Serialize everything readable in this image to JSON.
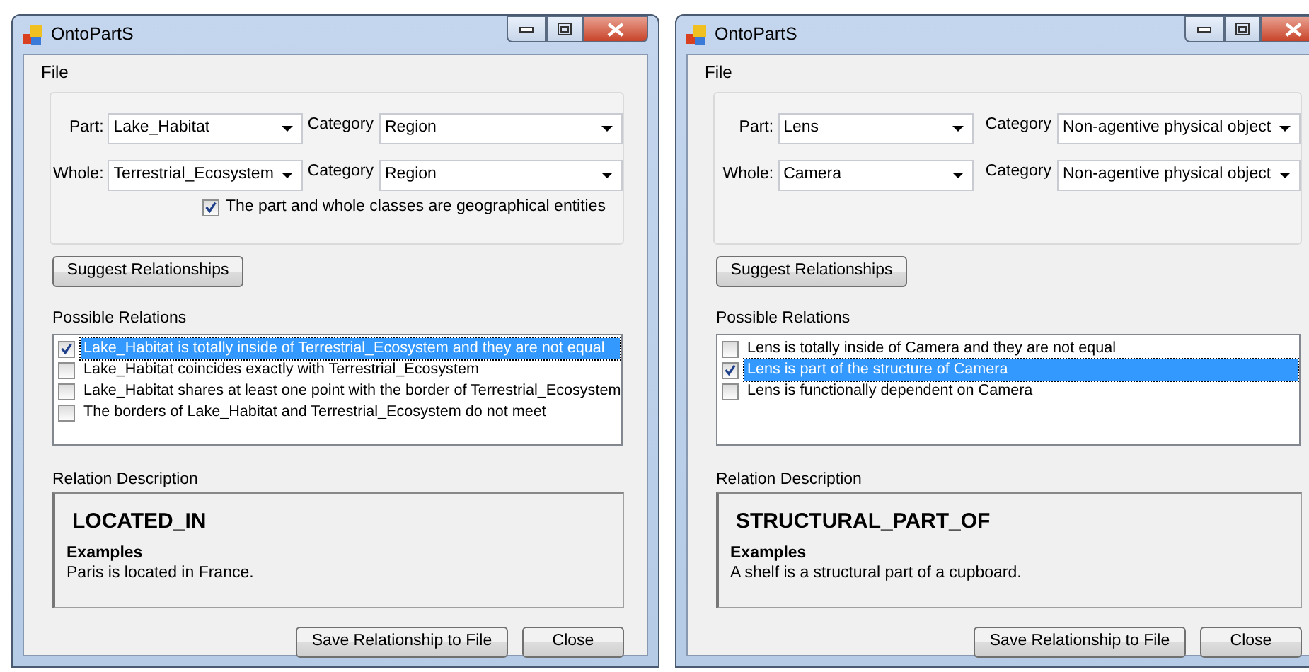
{
  "windows": [
    {
      "title": "OntoPartS",
      "menu": [
        "File"
      ],
      "part": {
        "label": "Part:",
        "value": "Lake_Habitat",
        "category_label": "Category",
        "category": "Region"
      },
      "whole": {
        "label": "Whole:",
        "value": "Terrestrial_Ecosystem",
        "category_label": "Category",
        "category": "Region"
      },
      "geo_checkbox": {
        "label": "The part and whole classes are geographical entities",
        "checked": true
      },
      "suggest_button": "Suggest Relationships",
      "relations_label": "Possible Relations",
      "relations": [
        {
          "text": "Lake_Habitat is totally inside of Terrestrial_Ecosystem and they are not equal",
          "checked": true,
          "selected": true
        },
        {
          "text": "Lake_Habitat coincides exactly with Terrestrial_Ecosystem",
          "checked": false,
          "selected": false
        },
        {
          "text": "Lake_Habitat shares at least one point with the border of Terrestrial_Ecosystem",
          "checked": false,
          "selected": false
        },
        {
          "text": "The borders of Lake_Habitat and Terrestrial_Ecosystem do not meet",
          "checked": false,
          "selected": false
        }
      ],
      "description_label": "Relation Description",
      "description": {
        "relation": "LOCATED_IN",
        "examples_heading": "Examples",
        "example": "Paris is located in France."
      },
      "buttons": [
        "Save Relationship to File",
        "Close"
      ]
    },
    {
      "title": "OntoPartS",
      "menu": [
        "File"
      ],
      "part": {
        "label": "Part:",
        "value": "Lens",
        "category_label": "Category",
        "category": "Non-agentive physical object"
      },
      "whole": {
        "label": "Whole:",
        "value": "Camera",
        "category_label": "Category",
        "category": "Non-agentive physical object"
      },
      "suggest_button": "Suggest Relationships",
      "relations_label": "Possible Relations",
      "relations": [
        {
          "text": "Lens is totally inside of Camera and they are not equal",
          "checked": false,
          "selected": false
        },
        {
          "text": "Lens is part of the structure of Camera",
          "checked": true,
          "selected": true
        },
        {
          "text": "Lens is functionally dependent on Camera",
          "checked": false,
          "selected": false
        }
      ],
      "description_label": "Relation Description",
      "description": {
        "relation": "STRUCTURAL_PART_OF",
        "examples_heading": "Examples",
        "example": "A shelf is a structural part of a cupboard."
      },
      "buttons": [
        "Save Relationship to File",
        "Close"
      ]
    }
  ]
}
